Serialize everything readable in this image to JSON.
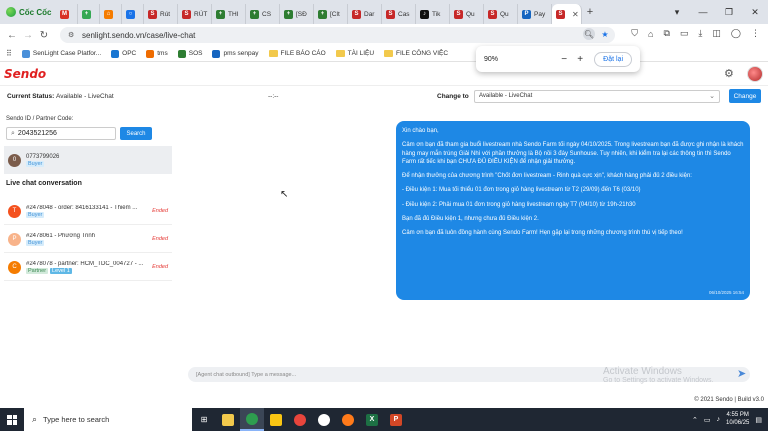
{
  "browser": {
    "brand": "Cốc Cốc",
    "tabs": [
      {
        "label": "",
        "color": "#d93025",
        "glyph": "M"
      },
      {
        "label": "",
        "color": "#34a853",
        "glyph": "+"
      },
      {
        "label": "",
        "color": "#f57c00",
        "glyph": "⌂"
      },
      {
        "label": "",
        "color": "#1a73e8",
        "glyph": "○"
      },
      {
        "label": "Rút",
        "color": "#c62828",
        "glyph": "S"
      },
      {
        "label": "RÚT",
        "color": "#c62828",
        "glyph": "S"
      },
      {
        "label": "THI",
        "color": "#2e7d32",
        "glyph": "+"
      },
      {
        "label": "CS",
        "color": "#2e7d32",
        "glyph": "+"
      },
      {
        "label": "[SĐ",
        "color": "#2e7d32",
        "glyph": "+"
      },
      {
        "label": "[Clt",
        "color": "#2e7d32",
        "glyph": "+"
      },
      {
        "label": "Dar",
        "color": "#c62828",
        "glyph": "S"
      },
      {
        "label": "Cas",
        "color": "#c62828",
        "glyph": "S"
      },
      {
        "label": "Tik",
        "color": "#111111",
        "glyph": "♪"
      },
      {
        "label": "Qu",
        "color": "#c62828",
        "glyph": "S"
      },
      {
        "label": "Qu",
        "color": "#c62828",
        "glyph": "S"
      },
      {
        "label": "Pay",
        "color": "#1565c0",
        "glyph": "P"
      },
      {
        "label": "",
        "color": "#c62828",
        "glyph": "S",
        "active": true
      }
    ],
    "url": "senlight.sendo.vn/case/live-chat",
    "bookmarks": [
      {
        "label": "SenLight Case Platfor...",
        "type": "icon",
        "color": "#4a90d9"
      },
      {
        "label": "OPC",
        "type": "icon",
        "color": "#1976d2"
      },
      {
        "label": "tms",
        "type": "icon",
        "color": "#ef6c00"
      },
      {
        "label": "SOS",
        "type": "icon",
        "color": "#2e7d32"
      },
      {
        "label": "pms senpay",
        "type": "icon",
        "color": "#1565c0"
      },
      {
        "label": "FILE BÁO CÁO",
        "type": "folder"
      },
      {
        "label": "TÀI LIỆU",
        "type": "folder"
      },
      {
        "label": "FILE CÔNG VIỆC",
        "type": "folder"
      }
    ],
    "zoom_popup": {
      "level": "90%",
      "minus": "−",
      "plus": "+",
      "reset_label": "Đặt lại"
    }
  },
  "app": {
    "logo": "Sendo",
    "status_label": "Current Status:",
    "status_value": "Available - LiveChat",
    "timer": "--:--",
    "change_to_label": "Change to",
    "change_to_value": "Available - LiveChat",
    "change_button": "Change"
  },
  "left": {
    "search_label": "Sendo ID / Partner Code:",
    "search_value": "2043521256",
    "search_button": "Search",
    "customer": {
      "avatar": "0",
      "phone": "0773799026",
      "badge": "Buyer"
    },
    "section_title": "Live chat conversation",
    "conversations": [
      {
        "avatar": "T",
        "color": "#f4511e",
        "title": "#2478048 - order: 8416133141 - Thiềm ...",
        "badges": [
          "Buyer"
        ],
        "status": "Ended"
      },
      {
        "avatar": "P",
        "color": "#f8b38a",
        "title": "#2478061 - Phương Trinh",
        "badges": [
          "Buyer"
        ],
        "status": "Ended"
      },
      {
        "avatar": "C",
        "color": "#f57c00",
        "title": "#2478078 - partner: HCM_TDC_004727 - ...",
        "badges": [
          "Partner",
          "Level 1"
        ],
        "status": "Ended"
      }
    ]
  },
  "chat": {
    "paragraphs": [
      "Xin chào bạn,",
      "Cảm ơn bạn đã tham gia buổi livestream nhà Sendo Farm tối ngày 04/10/2025. Trong livestream bạn đã được ghi nhận là khách hàng may mắn trúng Giải Nhì với phần thưởng là Bộ nồi 3 đáy Sunhouse. Tuy nhiên, khi kiểm tra lại các thông tin thì Sendo Farm rất tiếc khi bạn CHƯA ĐỦ ĐIỀU KIỆN để nhận giải thưởng.",
      "Để nhận thưởng của chương trình \"Chốt đơn livestream - Rinh quà cực xịn\", khách hàng phải đủ 2 điều kiện:",
      "- Điều kiện 1: Mua tối thiểu 01 đơn trong giỏ hàng livestream từ T2 (29/09) đến T6 (03/10)",
      "- Điều kiện 2: Phải mua 01 đơn trong giỏ hàng livestream ngày T7 (04/10) từ 19h-21h30",
      "Bạn đã đủ Điều kiện 1, nhưng chưa đủ Điều kiện 2.",
      "Cảm ơn bạn đã luôn đồng hành cùng Sendo Farm! Hẹn gặp lại trong những chương trình thú vị tiếp theo!"
    ],
    "timestamp": "06/10/2025 16:54",
    "composer_placeholder": "[Agent chat outbound] Type a message..."
  },
  "watermark": {
    "title": "Activate Windows",
    "sub": "Go to Settings to activate Windows."
  },
  "footer": "© 2021 Sendo | Build v3.0",
  "taskbar": {
    "search_placeholder": "Type here to search",
    "time": "4:55 PM",
    "date": "10/06/25"
  }
}
